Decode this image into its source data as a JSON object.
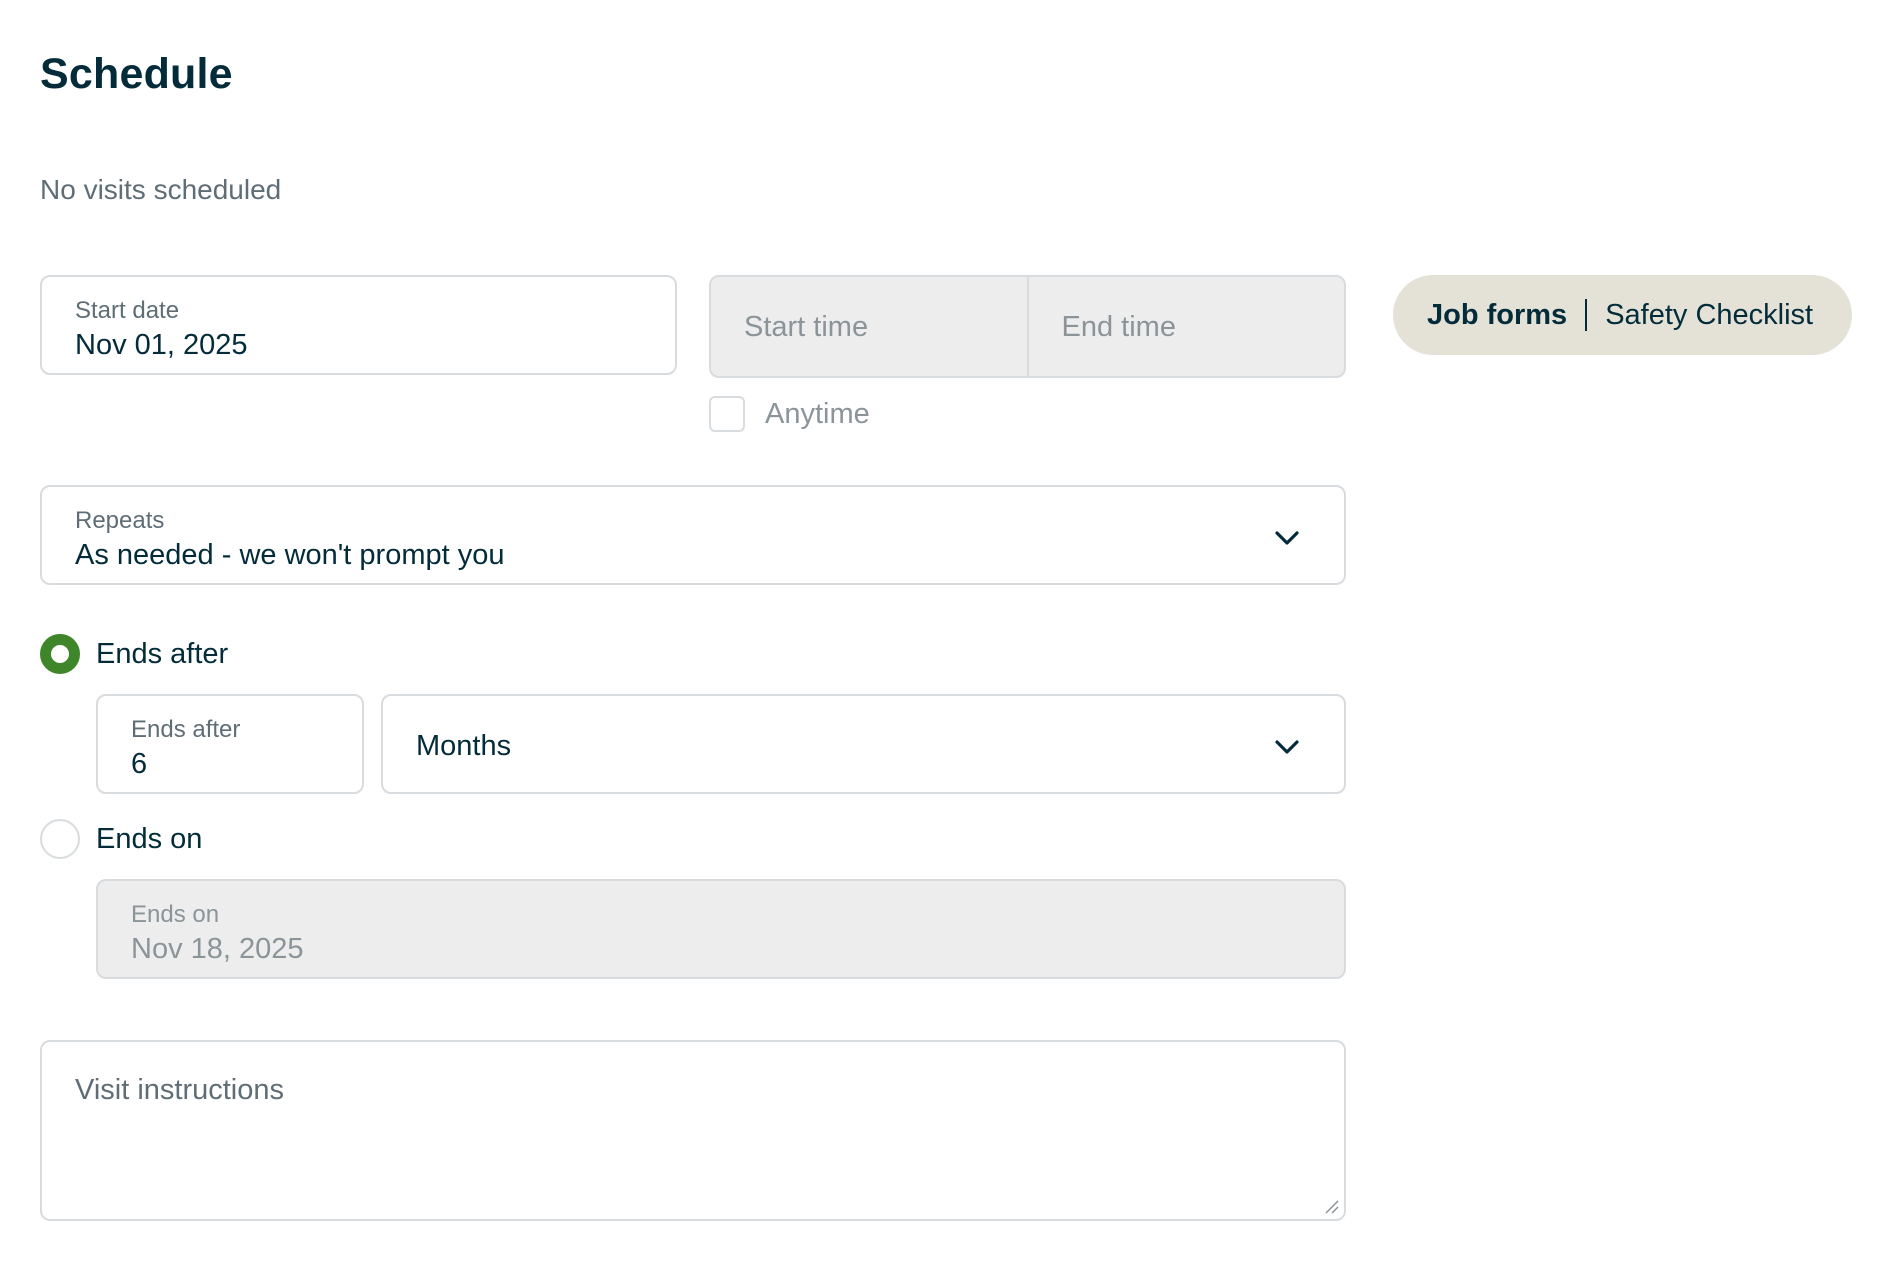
{
  "header": {
    "title": "Schedule",
    "subtitle": "No visits scheduled"
  },
  "start_date": {
    "label": "Start date",
    "value": "Nov 01, 2025"
  },
  "time": {
    "start_placeholder": "Start time",
    "end_placeholder": "End time",
    "anytime_label": "Anytime",
    "anytime_checked": false
  },
  "job_forms": {
    "label": "Job forms",
    "value": "Safety Checklist"
  },
  "repeats": {
    "label": "Repeats",
    "value": "As needed - we won't prompt you"
  },
  "ends": {
    "after_option_label": "Ends after",
    "after_selected": true,
    "after_count_label": "Ends after",
    "after_count_value": "6",
    "after_unit_value": "Months",
    "on_option_label": "Ends on",
    "on_selected": false,
    "on_date_label": "Ends on",
    "on_date_value": "Nov 18, 2025"
  },
  "instructions": {
    "placeholder": "Visit instructions"
  },
  "colors": {
    "text": "#032b3a",
    "muted": "#5f6e76",
    "radio_selected": "#3f862b",
    "pill_bg": "#e4e2d7",
    "disabled_bg": "#ededed"
  },
  "icons": {
    "dropdown": "chevron-down-icon",
    "resize": "resize-handle-icon"
  }
}
